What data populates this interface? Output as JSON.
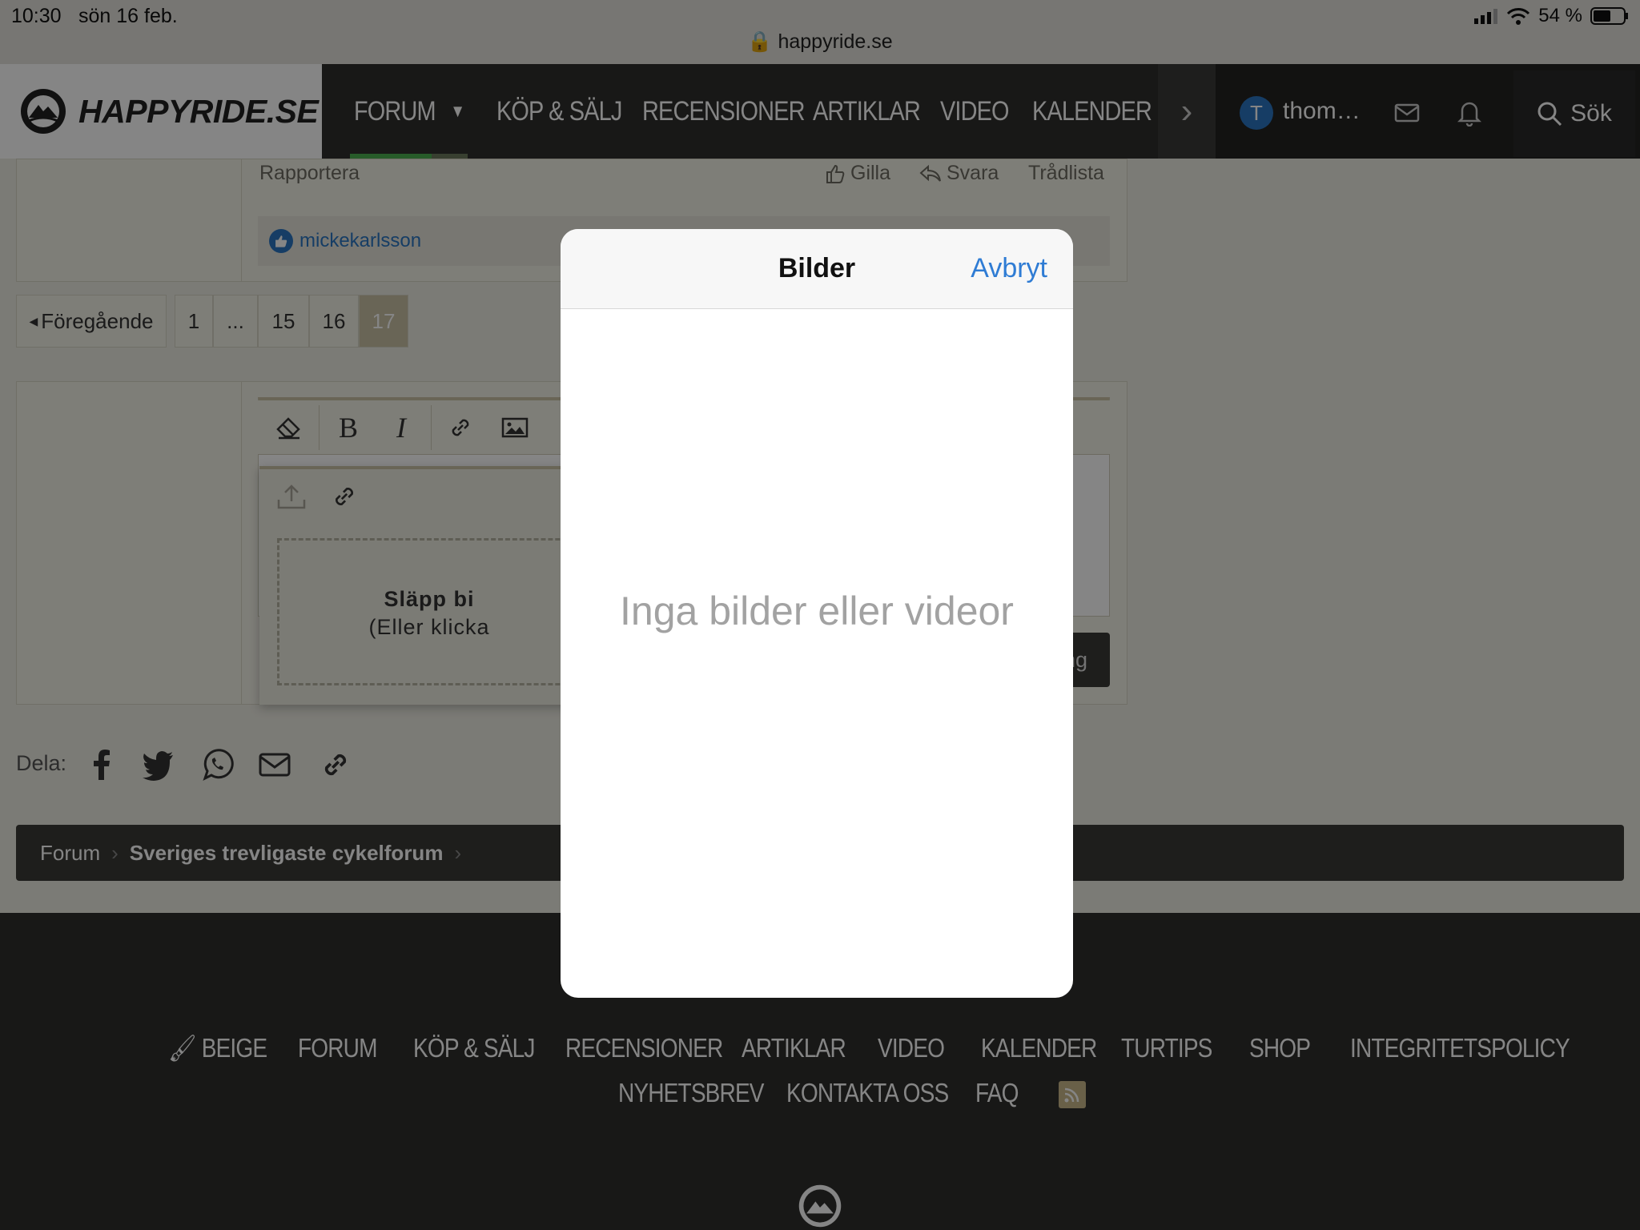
{
  "status": {
    "time": "10:30",
    "date": "sön 16 feb.",
    "url": "happyride.se",
    "battery": "54 %"
  },
  "nav": {
    "logo": "HAPPYRIDE.SE",
    "items": [
      "FORUM",
      "KÖP & SÄLJ",
      "RECENSIONER",
      "ARTIKLAR",
      "VIDEO",
      "KALENDER"
    ],
    "username": "thom…",
    "avatar_letter": "T",
    "search": "Sök"
  },
  "post": {
    "report": "Rapportera",
    "like": "Gilla",
    "reply": "Svara",
    "thread": "Trådlista",
    "reaction_user": "mickekarlsson"
  },
  "pagination": {
    "prev": "Föregående",
    "pages": [
      "1",
      "...",
      "15",
      "16",
      "17"
    ]
  },
  "editor": {
    "drop_title": "Släpp bi",
    "drop_sub": "(Eller klicka",
    "submit_partial": "ng"
  },
  "share": {
    "label": "Dela:"
  },
  "breadcrumb": {
    "root": "Forum",
    "current": "Sveriges trevligaste cykelforum"
  },
  "footer": {
    "row1": [
      "BEIGE",
      "FORUM",
      "KÖP & SÄLJ",
      "RECENSIONER",
      "ARTIKLAR",
      "VIDEO",
      "KALENDER",
      "TURTIPS",
      "SHOP",
      "INTEGRITETSPOLICY"
    ],
    "row2": [
      "NYHETSBREV",
      "KONTAKTA OSS",
      "FAQ"
    ]
  },
  "modal": {
    "title": "Bilder",
    "cancel": "Avbryt",
    "empty": "Inga bilder eller videor"
  },
  "colors": {
    "accent": "#2f7cd4",
    "nav_bg": "#2f2f2d",
    "active_bar": "#4caf50"
  }
}
